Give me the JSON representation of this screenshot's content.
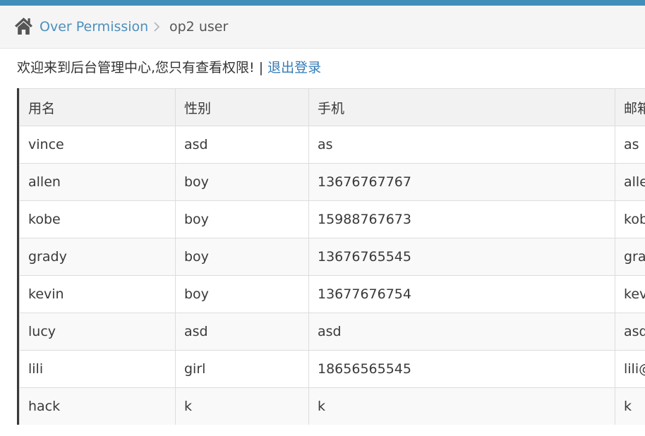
{
  "colors": {
    "topbar": "#438eb9",
    "breadcrumb_bg": "#f5f5f5",
    "link": "#4c8fbd",
    "logout_link": "#337ab7",
    "text": "#393939"
  },
  "breadcrumb": {
    "home_icon": "home-icon",
    "separator_icon": "chevron-right-icon",
    "parent_label": "Over Permission",
    "current_label": "op2 user"
  },
  "welcome": {
    "message": "欢迎来到后台管理中心,您只有查看权限!",
    "separator": "|",
    "logout_label": "退出登录"
  },
  "table": {
    "headers": [
      "用名",
      "性别",
      "手机",
      "邮箱"
    ],
    "rows": [
      [
        "vince",
        "asd",
        "as",
        "as"
      ],
      [
        "allen",
        "boy",
        "13676767767",
        "alle"
      ],
      [
        "kobe",
        "boy",
        "15988767673",
        "kob"
      ],
      [
        "grady",
        "boy",
        "13676765545",
        "grad"
      ],
      [
        "kevin",
        "boy",
        "13677676754",
        "kev"
      ],
      [
        "lucy",
        "asd",
        "asd",
        "asd"
      ],
      [
        "lili",
        "girl",
        "18656565545",
        "lili@"
      ],
      [
        "hack",
        "k",
        "k",
        "k"
      ]
    ]
  }
}
